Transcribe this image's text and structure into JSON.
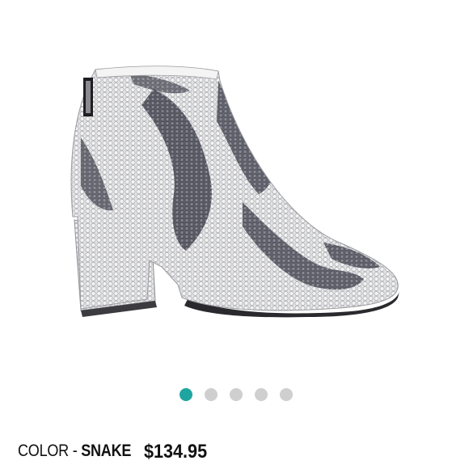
{
  "product": {
    "image_alt": "Snake print pointed-toe ankle bootie",
    "color_prefix": "COLOR - ",
    "color_name": "SNAKE",
    "price": "$134.95"
  },
  "carousel": {
    "total": 5,
    "active_index": 0,
    "active_color": "#1fa5a0",
    "inactive_color": "#cfcfcf"
  },
  "colors": {
    "text": "#111111",
    "background": "#ffffff"
  }
}
